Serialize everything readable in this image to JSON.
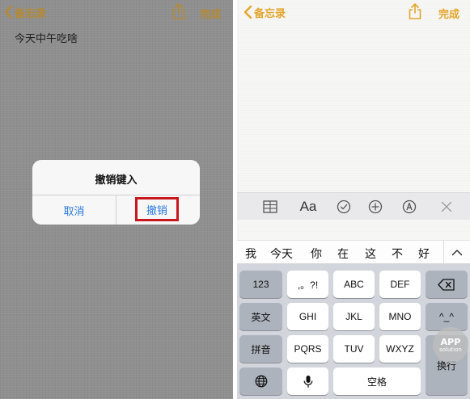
{
  "colors": {
    "accent": "#e3a52a",
    "alert_link": "#2a7ae2",
    "highlight_border": "#c8161d"
  },
  "left": {
    "nav": {
      "back_label": "备忘录",
      "done_label": "完成"
    },
    "note_text": "今天中午吃啥",
    "alert": {
      "title": "撤销键入",
      "cancel_label": "取消",
      "undo_label": "撤销"
    }
  },
  "right": {
    "nav": {
      "back_label": "备忘录",
      "done_label": "完成"
    },
    "format_bar": {
      "items": [
        {
          "icon": "table-icon"
        },
        {
          "label": "Aa",
          "icon": "text-style-icon"
        },
        {
          "icon": "checklist-icon"
        },
        {
          "icon": "add-icon"
        },
        {
          "icon": "markup-pen-icon"
        },
        {
          "icon": "close-icon"
        }
      ]
    },
    "candidates": [
      "我",
      "今天",
      "你",
      "在",
      "这",
      "不",
      "好"
    ],
    "keyboard": {
      "row1": [
        "123",
        ",。?!",
        "ABC",
        "DEF"
      ],
      "row2": [
        "英文",
        "GHI",
        "JKL",
        "MNO",
        "^_^"
      ],
      "row3": [
        "拼音",
        "PQRS",
        "TUV",
        "WXYZ"
      ],
      "row4_space": "空格",
      "return_label": "换行"
    }
  },
  "watermark": {
    "line1": "APP",
    "line2": "solution"
  }
}
